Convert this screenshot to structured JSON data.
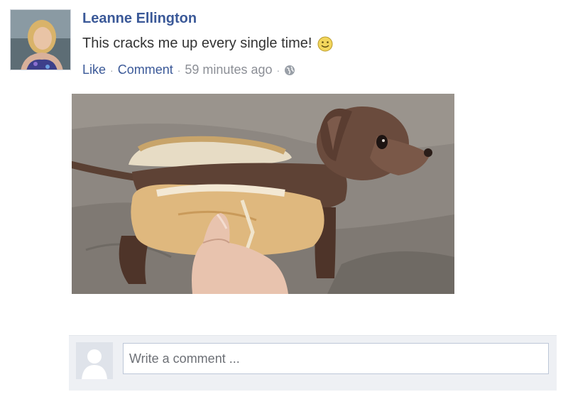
{
  "post": {
    "author": "Leanne Ellington",
    "text": "This cracks me up every single time!",
    "emoji": "smiley-emoji",
    "actions": {
      "like": "Like",
      "comment": "Comment"
    },
    "separator": "·",
    "timestamp": "59 minutes ago",
    "privacy_icon": "globe-icon"
  },
  "comment_box": {
    "placeholder": "Write a comment ..."
  },
  "colors": {
    "link": "#3b5998",
    "meta": "#8c8f96",
    "comment_bg": "#eef0f4"
  }
}
